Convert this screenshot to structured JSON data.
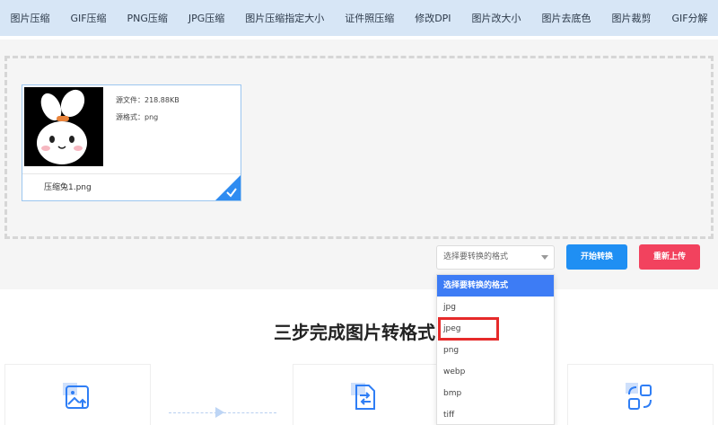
{
  "nav": {
    "items": [
      "图片压缩",
      "GIF压缩",
      "PNG压缩",
      "JPG压缩",
      "图片压缩指定大小",
      "证件照压缩",
      "修改DPI",
      "图片改大小",
      "图片去底色",
      "图片裁剪",
      "GIF分解"
    ]
  },
  "file": {
    "size_label": "源文件：218.88KB",
    "format_label": "源格式：png",
    "name": "压缩兔1.png"
  },
  "controls": {
    "select_placeholder": "选择要转换的格式",
    "start_label": "开始转换",
    "reupload_label": "重新上传"
  },
  "dropdown": {
    "options": [
      "选择要转换的格式",
      "jpg",
      "jpeg",
      "png",
      "webp",
      "bmp",
      "tiff"
    ],
    "selected_index": 0,
    "highlighted": "jpeg"
  },
  "section": {
    "title": "三步完成图片转格式"
  },
  "colors": {
    "nav_bg": "#d7e6f6",
    "primary": "#1f8ff3",
    "danger": "#f2425e",
    "selected": "#3d7cf5",
    "highlight": "#e62a2a"
  }
}
